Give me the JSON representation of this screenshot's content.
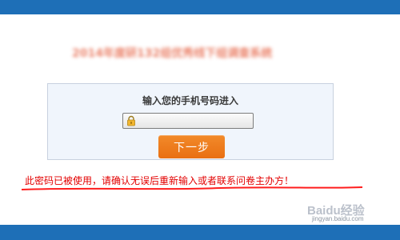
{
  "page": {
    "title": "2014年度研132组优秀线下组调查系统"
  },
  "login": {
    "prompt": "输入您的手机号码进入",
    "phone_input": {
      "value": "",
      "placeholder": ""
    },
    "next_label": "下一步"
  },
  "error": {
    "message": "此密码已被使用，请确认无误后重新输入或者联系问卷主办方！"
  },
  "watermark": {
    "logo": "Baidu经验",
    "url": "jingyan.baidu.com"
  },
  "colors": {
    "top_bar": "#1e6fb7",
    "bottom_bar": "#1e6fb7",
    "button": "#ef7d1e",
    "error_text": "#e30000"
  },
  "icons": {
    "input_icon": "lock-icon"
  }
}
